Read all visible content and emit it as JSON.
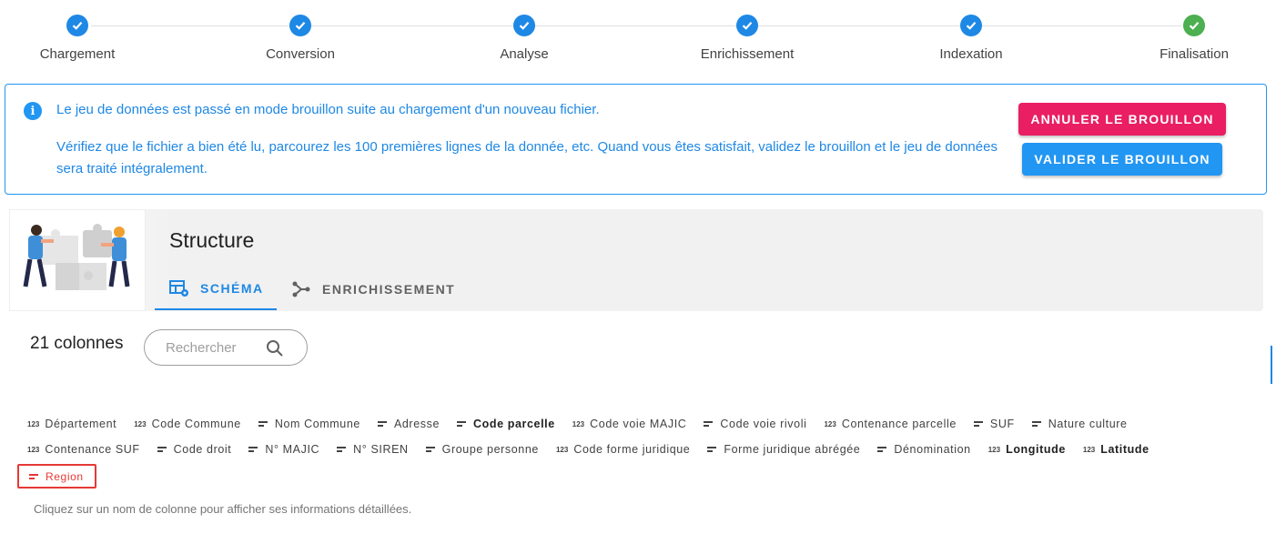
{
  "stepper": {
    "steps": [
      {
        "label": "Chargement",
        "status": "done"
      },
      {
        "label": "Conversion",
        "status": "done"
      },
      {
        "label": "Analyse",
        "status": "done"
      },
      {
        "label": "Enrichissement",
        "status": "done"
      },
      {
        "label": "Indexation",
        "status": "done"
      },
      {
        "label": "Finalisation",
        "status": "complete"
      }
    ],
    "colors": {
      "done": "#1e88e5",
      "complete": "#4caf50"
    }
  },
  "alert": {
    "icon": "info-icon",
    "message": "Le jeu de données est passé en mode brouillon suite au chargement d'un nouveau fichier.",
    "instructions": "Vérifiez que le fichier a bien été lu, parcourez les 100 premières lignes de la donnée, etc. Quand vous êtes satisfait, validez le brouillon et le jeu de données sera traité intégralement.",
    "cancel_label": "ANNULER LE BROUILLON",
    "validate_label": "VALIDER LE BROUILLON",
    "colors": {
      "accent": "#2196f3",
      "cancel": "#e91e63",
      "validate": "#2196f3"
    }
  },
  "structure": {
    "title": "Structure",
    "tabs": [
      {
        "label": "SCHÉMA",
        "icon": "table-settings-icon",
        "active": true
      },
      {
        "label": "ENRICHISSEMENT",
        "icon": "graph-icon",
        "active": false
      }
    ]
  },
  "columns": {
    "count_label": "21 colonnes",
    "search_placeholder": "Rechercher",
    "items": [
      {
        "label": "Département",
        "type": "number",
        "bold": false
      },
      {
        "label": "Code Commune",
        "type": "number",
        "bold": false
      },
      {
        "label": "Nom Commune",
        "type": "string",
        "bold": false
      },
      {
        "label": "Adresse",
        "type": "string",
        "bold": false
      },
      {
        "label": "Code parcelle",
        "type": "string",
        "bold": true
      },
      {
        "label": "Code voie MAJIC",
        "type": "number",
        "bold": false
      },
      {
        "label": "Code voie rivoli",
        "type": "string",
        "bold": false
      },
      {
        "label": "Contenance parcelle",
        "type": "number",
        "bold": false
      },
      {
        "label": "SUF",
        "type": "string",
        "bold": false
      },
      {
        "label": "Nature culture",
        "type": "string",
        "bold": false
      },
      {
        "label": "Contenance SUF",
        "type": "number",
        "bold": false
      },
      {
        "label": "Code droit",
        "type": "string",
        "bold": false
      },
      {
        "label": "N° MAJIC",
        "type": "string",
        "bold": false
      },
      {
        "label": "N° SIREN",
        "type": "string",
        "bold": false
      },
      {
        "label": "Groupe personne",
        "type": "string",
        "bold": false
      },
      {
        "label": "Code forme juridique",
        "type": "number",
        "bold": false
      },
      {
        "label": "Forme juridique abrégée",
        "type": "string",
        "bold": false
      },
      {
        "label": "Dénomination",
        "type": "string",
        "bold": false
      },
      {
        "label": "Longitude",
        "type": "number",
        "bold": true
      },
      {
        "label": "Latitude",
        "type": "number",
        "bold": true
      },
      {
        "label": "Region",
        "type": "string",
        "bold": false,
        "highlighted": true
      }
    ],
    "number_icon_text": "123",
    "hint": "Cliquez sur un nom de colonne pour afficher ses informations détaillées."
  }
}
